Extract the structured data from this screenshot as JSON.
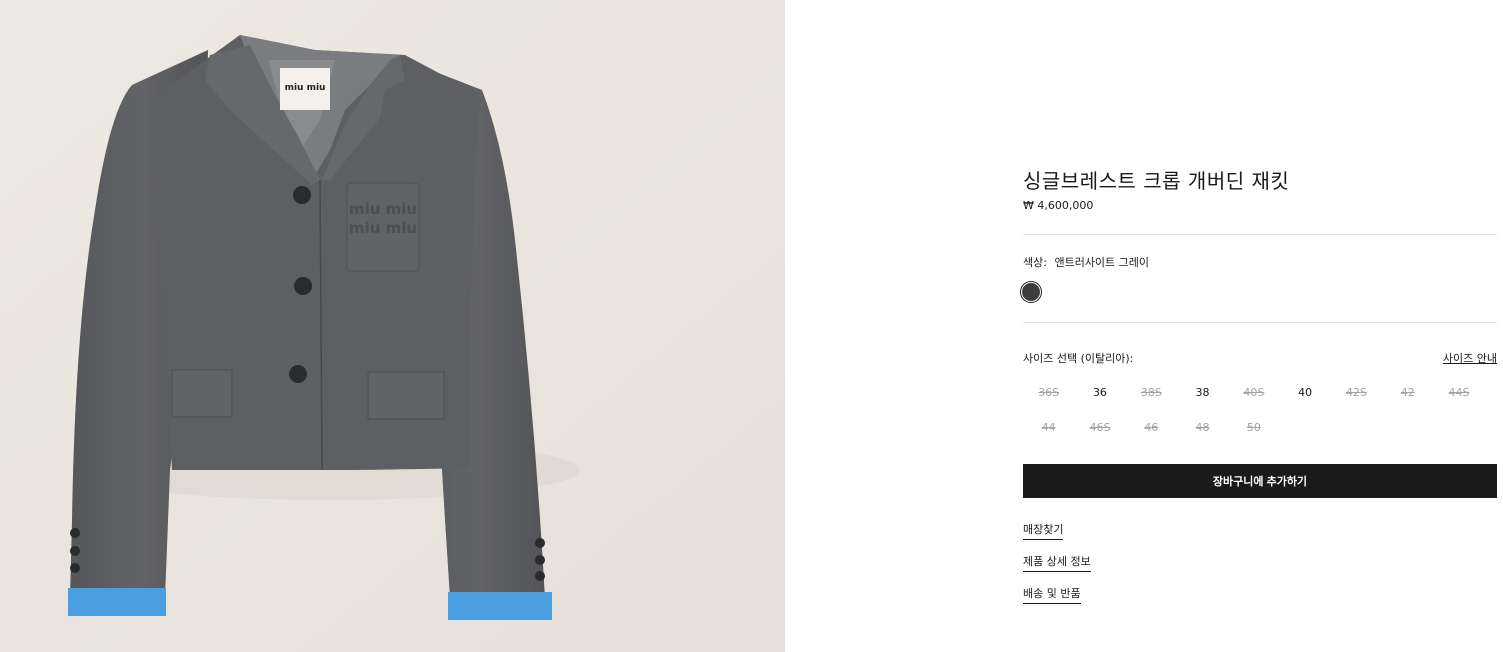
{
  "product": {
    "title": "싱글브레스트 크롭 개버딘 재킷",
    "price": "₩ 4,600,000",
    "image_alt": "Gray cropped single-breasted jacket with blue cuffs",
    "label_text": "miu miu",
    "pocket_logo_text": "miu miu"
  },
  "color": {
    "label": "색상:",
    "value": "앤트러사이트 그레이",
    "swatch_hex": "#3d3d3d"
  },
  "sizes": {
    "label": "사이즈 선택 (이탈리아):",
    "guide_link": "사이즈 안내",
    "options": [
      {
        "label": "36S",
        "available": false
      },
      {
        "label": "36",
        "available": true
      },
      {
        "label": "38S",
        "available": false
      },
      {
        "label": "38",
        "available": true
      },
      {
        "label": "40S",
        "available": false
      },
      {
        "label": "40",
        "available": true
      },
      {
        "label": "42S",
        "available": false
      },
      {
        "label": "42",
        "available": false
      },
      {
        "label": "44S",
        "available": false
      },
      {
        "label": "44",
        "available": false
      },
      {
        "label": "46S",
        "available": false
      },
      {
        "label": "46",
        "available": false
      },
      {
        "label": "48",
        "available": false
      },
      {
        "label": "50",
        "available": false
      }
    ]
  },
  "actions": {
    "add_to_cart": "장바구니에 추가하기"
  },
  "links": {
    "find_store": "매장찾기",
    "product_details": "제품 상세 정보",
    "shipping_returns": "배송 및 반품"
  },
  "colors": {
    "image_bg": "#ebe7e1",
    "jacket_gray": "#5d5e61",
    "cuff_blue": "#4a9fe0",
    "button_bg": "#1a1a1a"
  }
}
